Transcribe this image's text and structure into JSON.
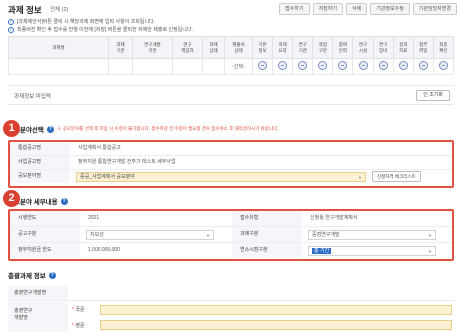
{
  "header": {
    "title": "과제 정보",
    "subtitle": "전체 (2)",
    "buttons": [
      "접수하기",
      "저장하기",
      "삭제",
      "기관정보수정",
      "기관담당자변경"
    ]
  },
  "notices": [
    "[과제제안서]버튼 클릭 시 해당과제 화면에 입력 사항이 조회됩니다.",
    "최종버전 확인 후 접수를 진행 이전에 [저장] 버튼을 클릭한 뒤에만 제출로 인정됩니다."
  ],
  "top_table": {
    "headers": [
      "과제명",
      "과제\n구분",
      "연구개발\n기관",
      "연구\n책임자",
      "과제\n상태",
      "제출서\n상태",
      "기본\n정보",
      "과제\n요약",
      "연구\n기관",
      "과업\n구분",
      "참여\n인력",
      "연구\n시설",
      "연구\n장비",
      "성과\n지표",
      "첨부\n파일",
      "최종\n확인"
    ],
    "row_status": "-선택-"
  },
  "report": {
    "label": "과제정보 미입력",
    "button": "인 조기화"
  },
  "section1": {
    "badge": "1",
    "title": "공모분야선택",
    "warning": "※ 공모분야를 선택 후 저장 시 수정이 불가합니다. 접수마감 전 수정이 필요할 경우 접수취소 후 재작성하시기 바랍니다.",
    "rows": [
      {
        "label": "통합공고명",
        "value": "사업계획서 통합공고"
      },
      {
        "label": "사업공고명",
        "value": "정부지원 통합연구개발 전주기 테스트 세부사업"
      }
    ],
    "field_label": "공모분야명",
    "field_value": "중공_사업계획서 공모분야",
    "button": "신청자격 체크리스트"
  },
  "section2": {
    "badge": "2",
    "title": "공모분야 세부내용",
    "rows": [
      {
        "l1": "시행연도",
        "v1": "2021",
        "l2": "접수유형",
        "v2": "신청용 연구개발계획서"
      },
      {
        "l1": "공고구분",
        "v1": "지보성",
        "l2": "과제구분",
        "v2": "중점연구개발"
      },
      {
        "l1": "정부지원금 한도",
        "v1": "1,000,000,000",
        "l2": "연소시점구분",
        "v2": "총 기간"
      }
    ]
  },
  "section3": {
    "title": "총괄과제 정보",
    "rows": [
      "총괄연구개발명",
      "총괄연구\n개발명"
    ],
    "sub_fields": [
      "국문",
      "영문"
    ]
  },
  "colors": {
    "highlight_border": "#e0523f",
    "badge": "#d9402f",
    "accent_blue": "#2b6cc4",
    "input_yellow": "#fdf1d3"
  }
}
